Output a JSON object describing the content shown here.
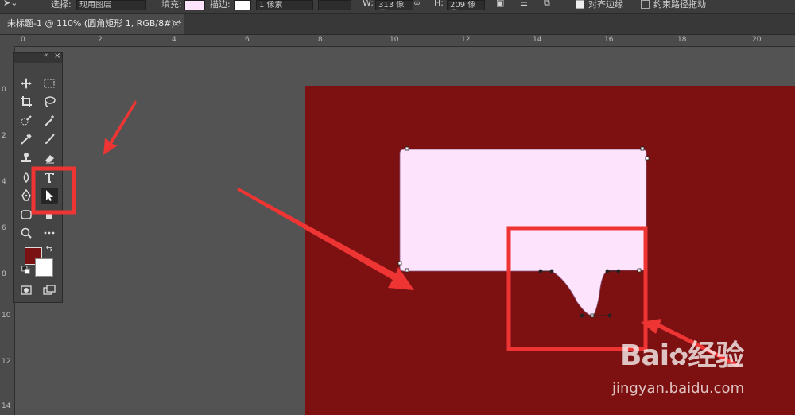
{
  "colors": {
    "canvas": "#7d1112",
    "shape_fill": "#fde3fb",
    "highlight": "#ef3434",
    "foreground": "#7a1112",
    "background": "#ffffff"
  },
  "options_bar": {
    "select_label": "选择:",
    "select_value": "现用图层",
    "fill_label": "填充:",
    "stroke_label": "描边:",
    "stroke_width": "1 像素",
    "w_label": "W:",
    "w_value": "313 像素",
    "h_label": "H:",
    "h_value": "209 像素",
    "align_edges_label": "对齐边缘",
    "constrain_path_label": "约束路径拖动"
  },
  "document_tab": {
    "title": "未标题-1 @ 110% (圆角矩形 1, RGB/8#) *",
    "close": "×"
  },
  "ruler_top_labels": [
    "0",
    "2",
    "4",
    "6",
    "8",
    "10",
    "12",
    "14",
    "16",
    "18",
    "20"
  ],
  "ruler_left_labels": [
    "0",
    "2",
    "4",
    "6",
    "8",
    "10",
    "12",
    "14"
  ],
  "toolbox": {
    "collapse": "«",
    "close": "×",
    "tools": [
      "move-tool",
      "marquee-tool",
      "crop-tool",
      "lasso-tool",
      "quick-selection-tool",
      "magic-wand-tool",
      "eyedropper-tool",
      "brush-tool",
      "stamp-tool",
      "eraser-tool",
      "pen-tool",
      "type-tool",
      "direct-selection-tool",
      "shape-tool",
      "hand-tool",
      "zoom-tool",
      "more-tools",
      "screen-mode-tool",
      "swap-colors-icon",
      "default-colors-icon"
    ]
  },
  "watermark": {
    "brand": "Bai",
    "brand_suffix": "经验",
    "url": "jingyan.baidu.com"
  }
}
